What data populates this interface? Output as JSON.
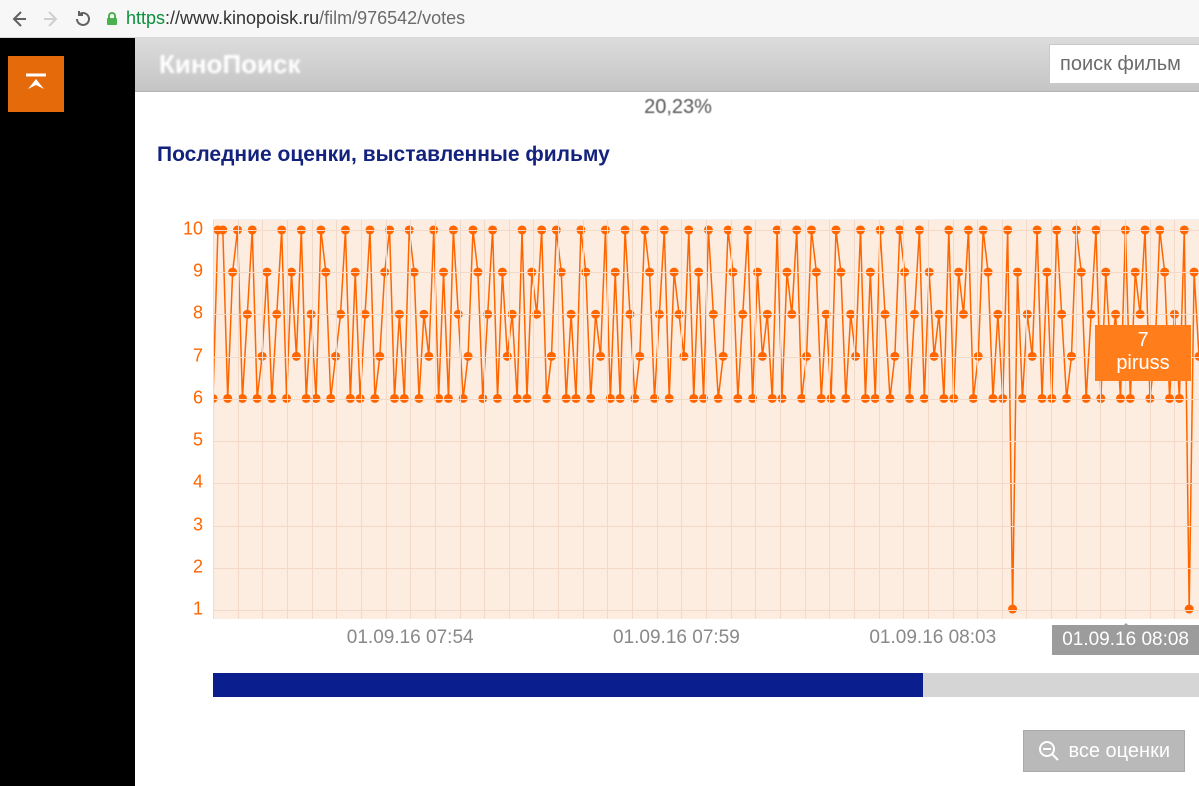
{
  "browser": {
    "url_proto": "https",
    "url_host": "://www.kinopoisk.ru",
    "url_path": "/film/976542/votes"
  },
  "header": {
    "logo": "КиноПоиск",
    "search_placeholder": "поиск фильм"
  },
  "stat": "20,23%",
  "heading": "Последние оценки, выставленные фильму",
  "chart_data": {
    "type": "line",
    "ylabel": "",
    "xlabel": "",
    "ylim": [
      1,
      10
    ],
    "yticks": [
      10,
      9,
      8,
      7,
      6,
      5,
      4,
      3,
      2,
      1
    ],
    "xticks": [
      "01.09.16 07:54",
      "01.09.16 07:59",
      "01.09.16 08:03",
      "01.09.16 08:08"
    ],
    "xtick_pos": [
      0.2,
      0.47,
      0.73,
      1.0
    ],
    "values": [
      6,
      10,
      10,
      6,
      9,
      10,
      6,
      8,
      10,
      6,
      7,
      9,
      6,
      8,
      10,
      6,
      9,
      7,
      10,
      6,
      8,
      6,
      10,
      9,
      6,
      7,
      8,
      10,
      6,
      9,
      6,
      8,
      10,
      6,
      7,
      9,
      10,
      6,
      8,
      6,
      10,
      9,
      6,
      8,
      7,
      10,
      6,
      9,
      6,
      10,
      8,
      6,
      7,
      10,
      9,
      6,
      8,
      10,
      6,
      9,
      7,
      8,
      6,
      10,
      6,
      9,
      8,
      10,
      6,
      7,
      10,
      9,
      6,
      8,
      6,
      10,
      9,
      6,
      8,
      7,
      10,
      6,
      9,
      6,
      10,
      8,
      6,
      7,
      10,
      9,
      6,
      8,
      10,
      6,
      9,
      8,
      7,
      10,
      6,
      9,
      6,
      10,
      8,
      6,
      7,
      10,
      9,
      6,
      8,
      10,
      6,
      9,
      7,
      8,
      6,
      10,
      6,
      9,
      8,
      10,
      6,
      7,
      10,
      9,
      6,
      8,
      6,
      10,
      9,
      6,
      8,
      7,
      10,
      6,
      9,
      6,
      10,
      8,
      6,
      7,
      10,
      9,
      6,
      8,
      10,
      6,
      9,
      7,
      8,
      6,
      10,
      6,
      9,
      8,
      10,
      6,
      7,
      10,
      9,
      6,
      8,
      6,
      10,
      1,
      9,
      6,
      8,
      7,
      10,
      6,
      9,
      6,
      10,
      8,
      6,
      7,
      10,
      9,
      6,
      8,
      10,
      6,
      9,
      7,
      8,
      6,
      10,
      6,
      9,
      8,
      10,
      6,
      7,
      10,
      9,
      6,
      8,
      6,
      10,
      1,
      9,
      7
    ]
  },
  "tooltip": {
    "value": "7",
    "user": "piruss",
    "time": "01.09.16 08:08"
  },
  "scrub_fill_pct": 72,
  "zoom_out_label": "все оценки",
  "colors": {
    "accent": "#ff6600",
    "brand_orange": "#e46a0a",
    "navy": "#13227c",
    "slider": "#0b1e8e"
  }
}
